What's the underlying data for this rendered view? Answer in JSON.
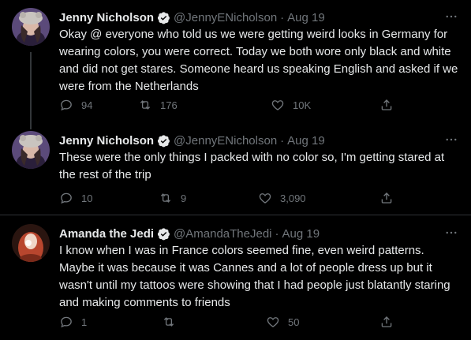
{
  "tweets": [
    {
      "name": "Jenny Nicholson",
      "handle": "@JennyENicholson",
      "date": "Aug 19",
      "text": "Okay @ everyone who told us we were getting weird looks in Germany for wearing colors, you were correct. Today we both wore only black and white and did not get stares. Someone heard us speaking English and asked if we were from the Netherlands",
      "replies": "94",
      "retweets": "176",
      "likes": "10K"
    },
    {
      "name": "Jenny Nicholson",
      "handle": "@JennyENicholson",
      "date": "Aug 19",
      "text": "These were the only things I packed with no color so, I'm getting stared at the rest of the trip",
      "replies": "10",
      "retweets": "9",
      "likes": "3,090"
    },
    {
      "name": "Amanda the Jedi",
      "handle": "@AmandaTheJedi",
      "date": "Aug 19",
      "text": "I know when I was in France colors seemed fine, even weird patterns. Maybe it was because it was Cannes and a lot of people dress up but it wasn't until my tattoos were showing that I had people just blatantly staring and making comments to friends",
      "replies": "1",
      "retweets": "",
      "likes": "50"
    }
  ],
  "separator": "·",
  "colors": {
    "background": "#000000",
    "text": "#e7e9ea",
    "muted": "#71767b",
    "verified": "#1d9bf0",
    "thread_line": "#333639"
  },
  "icons": [
    "verified-badge-icon",
    "more-icon",
    "reply-icon",
    "retweet-icon",
    "like-icon",
    "share-icon"
  ]
}
